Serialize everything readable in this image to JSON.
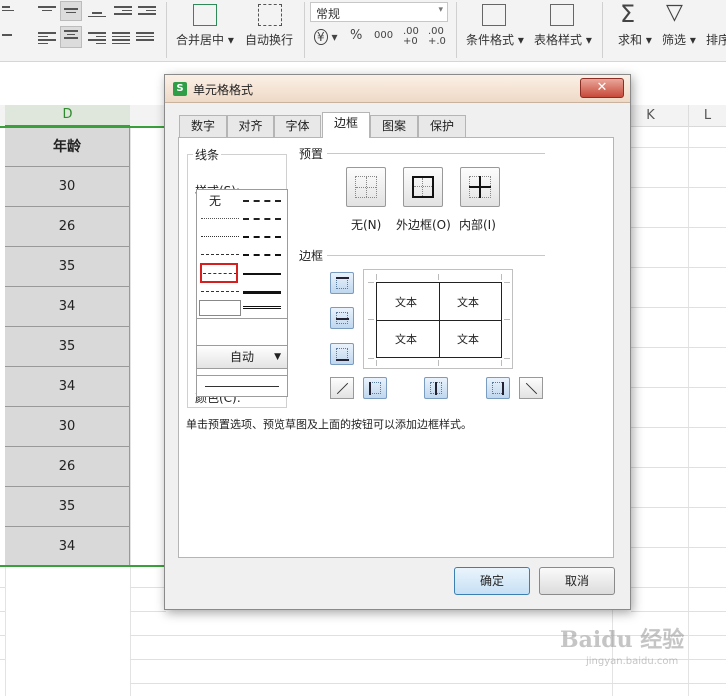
{
  "ribbon": {
    "number_format": "常规",
    "buttons": {
      "merge_center": "合并居中",
      "wrap_text": "自动换行",
      "conditional_format": "条件格式",
      "table_style": "表格样式",
      "sum": "求和",
      "filter": "筛选",
      "sort": "排序"
    },
    "currency_glyph": "¥",
    "percent_glyph": "%",
    "thousands_glyph": "000",
    "inc_decimal": ".00 +0",
    "dec_decimal": ".00 +.0"
  },
  "sheet": {
    "columns": [
      "D",
      "K",
      "L"
    ],
    "header_cell": "年龄",
    "ages": [
      "30",
      "26",
      "35",
      "34",
      "35",
      "34",
      "30",
      "26",
      "35",
      "34"
    ]
  },
  "dialog": {
    "title": "单元格格式",
    "close_glyph": "✕",
    "tabs": [
      "数字",
      "对齐",
      "字体",
      "边框",
      "图案",
      "保护"
    ],
    "active_tab": "边框",
    "line_group": {
      "title": "线条",
      "style_label": "样式(S):",
      "none_label": "无",
      "color_label": "颜色(C):",
      "color_value": "自动"
    },
    "preset_group": {
      "title": "预置",
      "none": "无(N)",
      "outline": "外边框(O)",
      "inside": "内部(I)"
    },
    "border_group": {
      "title": "边框",
      "preview_text": [
        "文本",
        "文本",
        "文本",
        "文本"
      ]
    },
    "hint": "单击预置选项、预览草图及上面的按钮可以添加边框样式。",
    "ok": "确定",
    "cancel": "取消"
  },
  "watermark": {
    "brand": "Baidu 经验",
    "url": "jingyan.baidu.com"
  }
}
